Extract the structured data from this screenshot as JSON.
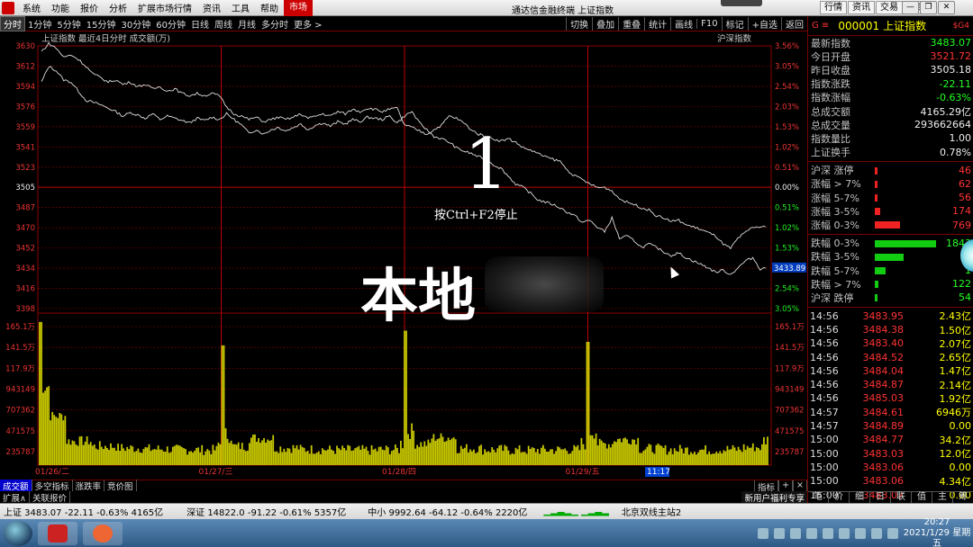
{
  "menubar": {
    "items": [
      "系统",
      "功能",
      "报价",
      "分析",
      "扩展市场行情",
      "资讯",
      "工具",
      "帮助",
      "市场"
    ],
    "active_index": 8,
    "title": "通达信金融终端  上证指数",
    "right_buttons": [
      "行情",
      "资讯",
      "交易",
      "服务"
    ]
  },
  "toolbar": {
    "items": [
      "分时",
      "1分钟",
      "5分钟",
      "15分钟",
      "30分钟",
      "60分钟",
      "日线",
      "周线",
      "月线",
      "多分时",
      "更多 >"
    ],
    "active_index": 0,
    "right_items": [
      "切换",
      "叠加",
      "重叠",
      "统计",
      "画线",
      "F10",
      "标记",
      "+自选",
      "返回"
    ]
  },
  "chart_data": {
    "type": "line",
    "title": "上证指数  最近4日分时  成交额(万)",
    "index_label": "沪深指数",
    "current_price_tag": "3433.89",
    "time_tag": "11:17",
    "price_axis_left": [
      "3630",
      "3612",
      "3594",
      "3576",
      "3559",
      "3541",
      "3523",
      "3505",
      "3487",
      "3470",
      "3452",
      "3434",
      "3416",
      "3398"
    ],
    "pct_axis_right": [
      "3.56%",
      "3.05%",
      "2.54%",
      "2.03%",
      "1.53%",
      "1.02%",
      "0.51%",
      "0.00%",
      "0.51%",
      "1.02%",
      "1.53%",
      "2.04%",
      "2.54%",
      "3.05%"
    ],
    "ylim": [
      3398,
      3630
    ],
    "baseline": 3505,
    "volume_axis_left": [
      "165.1万",
      "141.5万",
      "117.9万",
      "943149",
      "707362",
      "471575",
      "235787"
    ],
    "volume_axis_right": [
      "165.1万",
      "141.5万",
      "117.9万",
      "943149",
      "707362",
      "471575",
      "235787"
    ],
    "x_labels": [
      "01/26/二",
      "01/27/三",
      "01/28/四",
      "01/29/五"
    ],
    "series": [
      {
        "values": [
          3598,
          3612,
          3608,
          3600,
          3598,
          3590,
          3582,
          3580,
          3578,
          3575,
          3572,
          3568,
          3571,
          3569,
          3566,
          3570,
          3565,
          3568,
          3566,
          3564,
          3562,
          3566,
          3564,
          3567,
          3565,
          3570,
          3565,
          3560,
          3553,
          3556,
          3552,
          3556,
          3558,
          3555,
          3558,
          3561,
          3556,
          3560,
          3562,
          3559,
          3563,
          3561,
          3565,
          3563,
          3567,
          3566,
          3565,
          3568,
          3562,
          3568,
          3572,
          3562,
          3556,
          3550,
          3548,
          3545,
          3540,
          3537,
          3535,
          3532,
          3530,
          3525,
          3522,
          3515,
          3508,
          3505,
          3500,
          3494,
          3492,
          3490,
          3487,
          3483,
          3480,
          3474,
          3476,
          3470,
          3466,
          3478,
          3460,
          3462,
          3458,
          3452,
          3455,
          3452,
          3448,
          3445,
          3447,
          3443,
          3440,
          3437,
          3434,
          3430,
          3432,
          3428,
          3434,
          3440,
          3443,
          3433,
          3434
        ]
      },
      {
        "values": [
          3625,
          3632,
          3628,
          3620,
          3622,
          3618,
          3612,
          3605,
          3602,
          3598,
          3600,
          3596,
          3598,
          3594,
          3596,
          3592,
          3594,
          3590,
          3592,
          3588,
          3586,
          3588,
          3586,
          3588,
          3586,
          3576,
          3570,
          3568,
          3565,
          3567,
          3563,
          3565,
          3567,
          3565,
          3567,
          3570,
          3566,
          3568,
          3570,
          3568,
          3572,
          3570,
          3574,
          3572,
          3575,
          3574,
          3572,
          3574,
          3575,
          3560,
          3558,
          3555,
          3552,
          3556,
          3560,
          3568,
          3566,
          3562,
          3556,
          3552,
          3550,
          3548,
          3546,
          3548,
          3545,
          3540,
          3538,
          3535,
          3532,
          3530,
          3528,
          3520,
          3515,
          3512,
          3508,
          3505,
          3505,
          3502,
          3495,
          3492,
          3490,
          3487,
          3485,
          3480,
          3478,
          3475,
          3476,
          3472,
          3470,
          3468,
          3465,
          3462,
          3455,
          3451,
          3460,
          3465,
          3470,
          3470,
          3470
        ]
      }
    ],
    "day_volume_peaks": [
      1.45,
      0.62,
      0.45,
      0.39,
      0.36,
      0.34,
      0.33,
      0.45,
      0.72,
      0.4,
      0.35,
      0.33,
      0.32,
      0.34,
      0.53,
      0.74,
      0.38,
      0.34,
      0.32,
      0.33,
      0.34,
      0.53,
      0.68,
      0.37,
      0.34,
      0.33,
      0.35,
      0.42
    ]
  },
  "overlay": {
    "big_number": "1",
    "stop_hint": "按Ctrl+F2停止",
    "local_text": "本地"
  },
  "subbar": {
    "items": [
      "成交额",
      "多空指标",
      "涨跌率",
      "竞价图"
    ],
    "active_index": 0,
    "right_items": [
      "指标",
      "+",
      "×"
    ]
  },
  "subbar2": {
    "items": [
      "扩展∧",
      "关联报价"
    ],
    "right": "新用户福利专享"
  },
  "right_panel": {
    "g_label": "G  ≡",
    "code": "000001",
    "name": "上证指数",
    "version": "$G4",
    "quotes": [
      {
        "label": "最新指数",
        "value": "3483.07",
        "color": "green"
      },
      {
        "label": "今日开盘",
        "value": "3521.72",
        "color": "red"
      },
      {
        "label": "昨日收盘",
        "value": "3505.18",
        "color": "white"
      },
      {
        "label": "指数涨跌",
        "value": "-22.11",
        "color": "green"
      },
      {
        "label": "指数涨幅",
        "value": "-0.63%",
        "color": "green"
      },
      {
        "label": "总成交额",
        "value": "4165.29亿",
        "color": "white"
      },
      {
        "label": "总成交量",
        "value": "293662664",
        "color": "white"
      },
      {
        "label": "指数量比",
        "value": "1.00",
        "color": "white"
      },
      {
        "label": "上证换手",
        "value": "0.78%",
        "color": "white"
      }
    ],
    "breadth_up": [
      {
        "label": "沪深 涨停",
        "value": "46",
        "bar": 0.03
      },
      {
        "label": "涨幅 > 7%",
        "value": "62",
        "bar": 0.03
      },
      {
        "label": "涨幅 5-7%",
        "value": "56",
        "bar": 0.03
      },
      {
        "label": "涨幅 3-5%",
        "value": "174",
        "bar": 0.08
      },
      {
        "label": "涨幅 0-3%",
        "value": "769",
        "bar": 0.35
      }
    ],
    "breadth_down": [
      {
        "label": "跌幅 0-3%",
        "value": "1843",
        "bar": 0.85
      },
      {
        "label": "跌幅 3-5%",
        "value": "8",
        "bar": 0.4
      },
      {
        "label": "跌幅 5-7%",
        "value": "1",
        "bar": 0.15
      },
      {
        "label": "跌幅 > 7%",
        "value": "122",
        "bar": 0.05
      },
      {
        "label": "沪深 跌停",
        "value": "54",
        "bar": 0.03
      }
    ],
    "ticks": [
      {
        "t": "14:56",
        "p": "3483.95",
        "v": "2.43亿"
      },
      {
        "t": "14:56",
        "p": "3484.38",
        "v": "1.50亿"
      },
      {
        "t": "14:56",
        "p": "3483.40",
        "v": "2.07亿"
      },
      {
        "t": "14:56",
        "p": "3484.52",
        "v": "2.65亿"
      },
      {
        "t": "14:56",
        "p": "3484.04",
        "v": "1.47亿"
      },
      {
        "t": "14:56",
        "p": "3484.87",
        "v": "2.14亿"
      },
      {
        "t": "14:56",
        "p": "3485.03",
        "v": "1.92亿"
      },
      {
        "t": "14:57",
        "p": "3484.61",
        "v": "6946万"
      },
      {
        "t": "14:57",
        "p": "3484.89",
        "v": "0.00"
      },
      {
        "t": "15:00",
        "p": "3484.77",
        "v": "34.2亿"
      },
      {
        "t": "15:00",
        "p": "3483.03",
        "v": "12.0亿"
      },
      {
        "t": "15:00",
        "p": "3483.06",
        "v": "0.00"
      },
      {
        "t": "15:00",
        "p": "3483.06",
        "v": "4.34亿"
      },
      {
        "t": "15:00",
        "p": "3483.07",
        "v": "0.00"
      }
    ],
    "tabs": [
      "笔",
      "价",
      "细",
      "日",
      "联",
      "值",
      "主",
      "筹"
    ]
  },
  "statusbar": {
    "sh": "上证 3483.07  -22.11  -0.63% 4165亿",
    "sz": "深证 14822.0  -91.22  -0.61% 5357亿",
    "zx": "中小 9992.64  -64.12  -0.64% 2220亿",
    "server": "北京双线主站2"
  },
  "taskbar": {
    "time": "20:27",
    "date": "2021/1/29 星期五"
  }
}
